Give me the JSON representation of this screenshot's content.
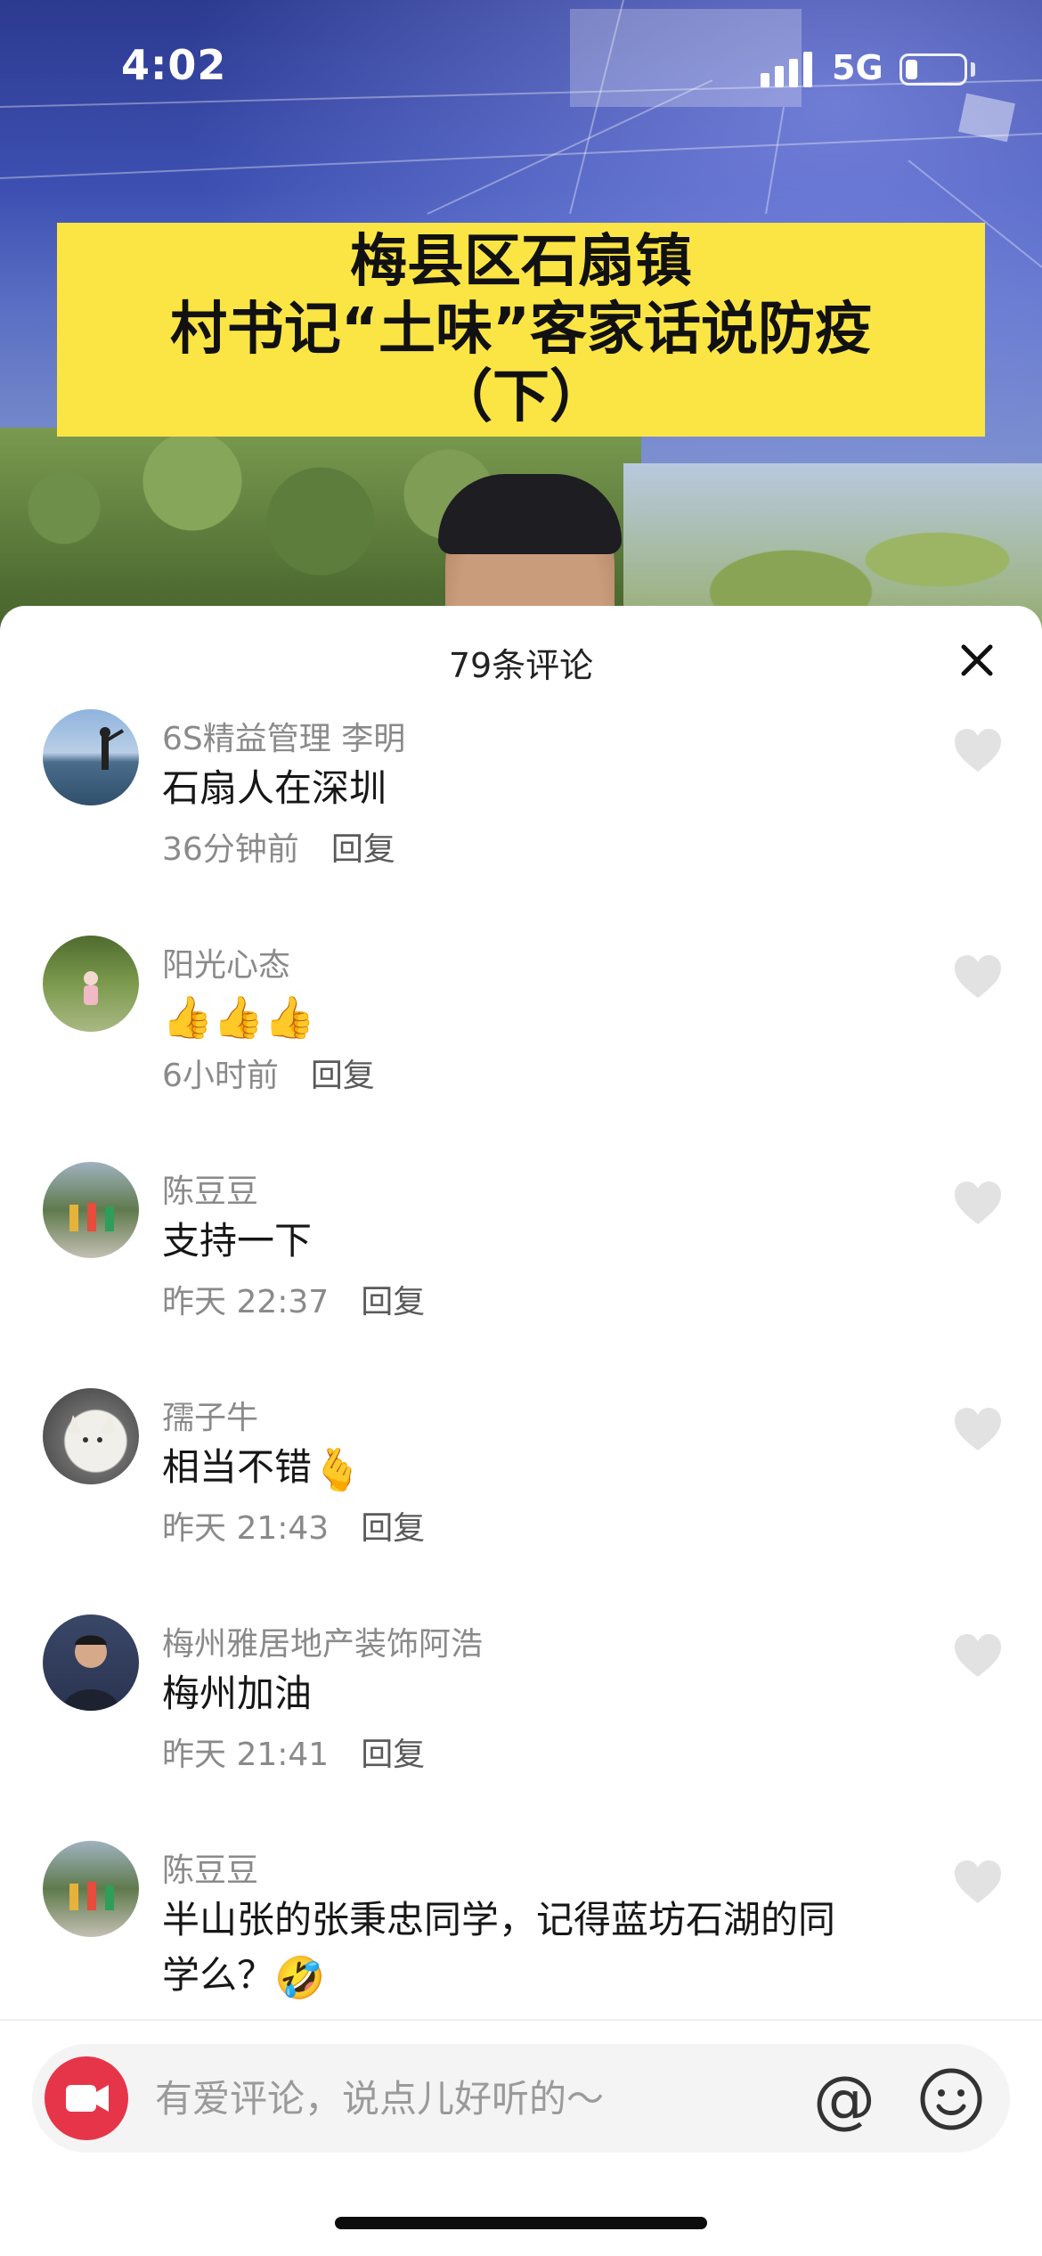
{
  "status_bar": {
    "time": "4:02",
    "network": "5G",
    "battery_level": 0.2
  },
  "video": {
    "title_lines": [
      "梅县区石扇镇",
      "村书记“土味”客家话说防疫",
      "（下）"
    ]
  },
  "comments_panel": {
    "title": "79条评论",
    "reply_label": "回复",
    "comments": [
      {
        "user": "6S精益管理 李明",
        "text": "石扇人在深圳",
        "emoji": "",
        "time": "36分钟前"
      },
      {
        "user": "阳光心态",
        "text": "",
        "emoji": "👍👍👍",
        "time": "6小时前"
      },
      {
        "user": "陈豆豆",
        "text": "支持一下",
        "emoji": "",
        "time": "昨天 22:37"
      },
      {
        "user": "孺子牛",
        "text": "相当不错",
        "emoji": "🫰",
        "time": "昨天 21:43"
      },
      {
        "user": "梅州雅居地产装饰阿浩",
        "text": "梅州加油",
        "emoji": "",
        "time": "昨天 21:41"
      },
      {
        "user": "陈豆豆",
        "text": "半山张的张秉忠同学，记得蓝坊石湖的同",
        "text2": "学么？",
        "emoji": "🤣",
        "time": ""
      }
    ]
  },
  "input_bar": {
    "placeholder": "有爱评论，说点儿好听的～",
    "at_symbol": "@"
  },
  "colors": {
    "banner": "#fbe544",
    "accent_red": "#e63549",
    "meta_gray": "#8a8a8a"
  }
}
